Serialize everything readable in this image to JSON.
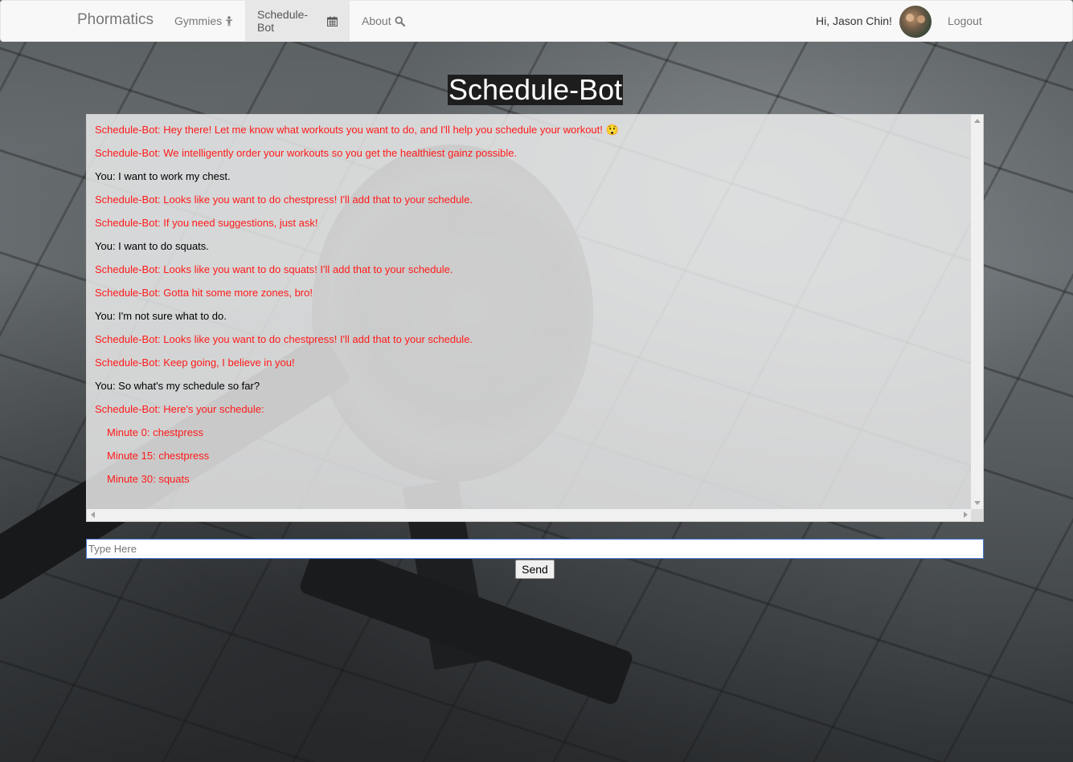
{
  "navbar": {
    "brand": "Phormatics",
    "items": [
      {
        "label": "Gymmies",
        "icon": "person-icon"
      },
      {
        "label": "Schedule-Bot",
        "icon": "calendar-icon",
        "active": true
      },
      {
        "label": "About",
        "icon": "search-icon"
      }
    ],
    "greeting": "Hi, Jason Chin!",
    "logout": "Logout"
  },
  "page": {
    "title": "Schedule-Bot"
  },
  "chat": {
    "messages": [
      {
        "sender": "bot",
        "text": "Schedule-Bot: Hey there! Let me know what workouts you want to do, and I'll help you schedule your workout! 😲"
      },
      {
        "sender": "bot",
        "text": "Schedule-Bot: We intelligently order your workouts so you get the healthiest gainz possible."
      },
      {
        "sender": "you",
        "text": "You: I want to work my chest."
      },
      {
        "sender": "bot",
        "text": "Schedule-Bot: Looks like you want to do chestpress! I'll add that to your schedule."
      },
      {
        "sender": "bot",
        "text": "Schedule-Bot: If you need suggestions, just ask!"
      },
      {
        "sender": "you",
        "text": "You: I want to do squats."
      },
      {
        "sender": "bot",
        "text": "Schedule-Bot: Looks like you want to do squats! I'll add that to your schedule."
      },
      {
        "sender": "bot",
        "text": "Schedule-Bot: Gotta hit some more zones, bro!"
      },
      {
        "sender": "you",
        "text": "You: I'm not sure what to do."
      },
      {
        "sender": "bot",
        "text": "Schedule-Bot: Looks like you want to do chestpress! I'll add that to your schedule."
      },
      {
        "sender": "bot",
        "text": "Schedule-Bot: Keep going, I believe in you!"
      },
      {
        "sender": "you",
        "text": "You: So what's my schedule so far?"
      },
      {
        "sender": "bot",
        "text": "Schedule-Bot: Here's your schedule:"
      },
      {
        "sender": "bot",
        "indent": true,
        "text": "Minute 0: chestpress"
      },
      {
        "sender": "bot",
        "indent": true,
        "text": "Minute 15: chestpress"
      },
      {
        "sender": "bot",
        "indent": true,
        "text": "Minute 30: squats"
      }
    ],
    "input_placeholder": "Type Here",
    "input_value": "",
    "send_label": "Send"
  },
  "colors": {
    "bot_text": "#ff1a1a",
    "user_text": "#000000",
    "navbar_bg": "#f8f8f8",
    "title_bg": "#1d1d1d"
  }
}
